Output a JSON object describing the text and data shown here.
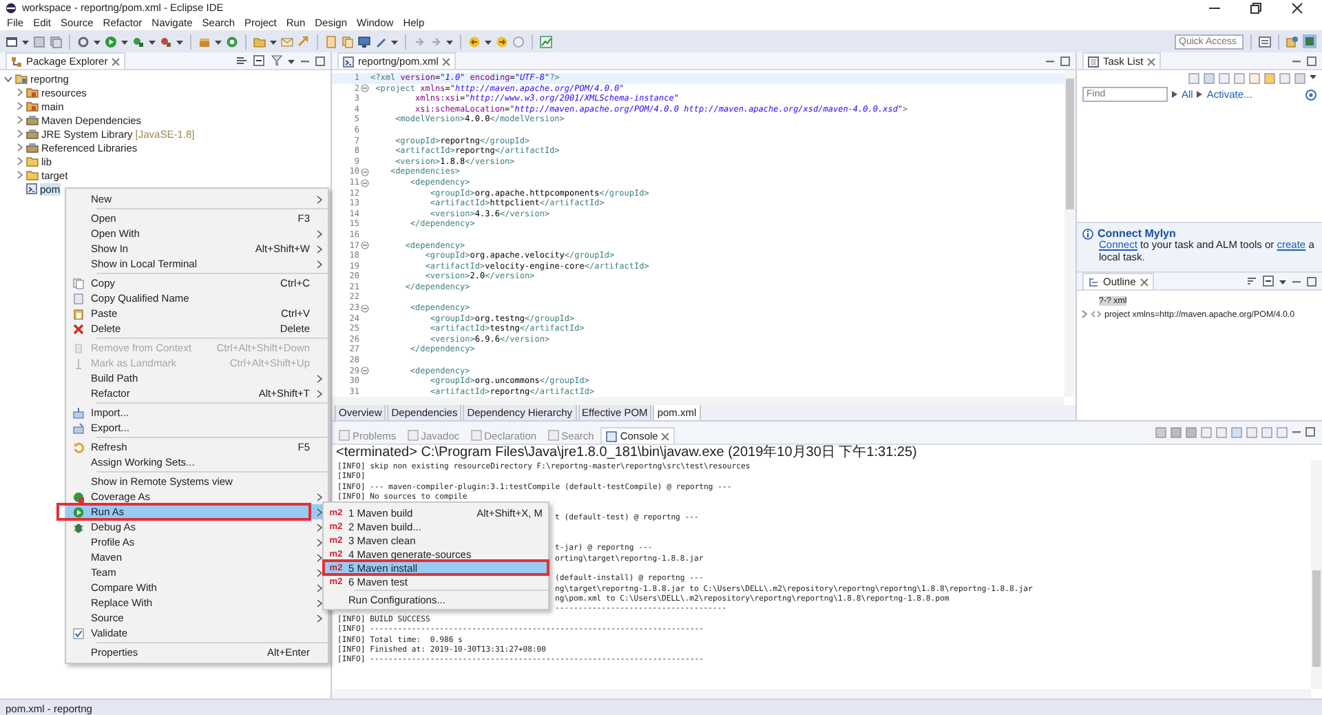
{
  "window": {
    "title": "workspace - reportng/pom.xml - Eclipse IDE"
  },
  "menu_bar": [
    "File",
    "Edit",
    "Source",
    "Refactor",
    "Navigate",
    "Search",
    "Project",
    "Run",
    "Design",
    "Window",
    "Help"
  ],
  "quick_access": {
    "placeholder": "Quick Access"
  },
  "package_explorer": {
    "title": "Package Explorer",
    "tree": [
      {
        "label": "reportng",
        "kind": "project",
        "expanded": true,
        "selected": false,
        "children": [
          {
            "label": "resources",
            "kind": "source-folder",
            "expanded": false,
            "selected": false
          },
          {
            "label": "main",
            "kind": "source-folder",
            "expanded": false,
            "selected": false
          },
          {
            "label": "Maven Dependencies",
            "kind": "library",
            "expanded": false,
            "selected": false
          },
          {
            "label": "JRE System Library",
            "decoration": "[JavaSE-1.8]",
            "kind": "library",
            "expanded": false,
            "selected": false
          },
          {
            "label": "Referenced Libraries",
            "kind": "library",
            "expanded": false,
            "selected": false
          },
          {
            "label": "lib",
            "kind": "folder",
            "expanded": false,
            "selected": false
          },
          {
            "label": "target",
            "kind": "folder",
            "expanded": false,
            "selected": false
          },
          {
            "label": "pom",
            "kind": "file",
            "selected": true
          }
        ]
      }
    ]
  },
  "editor": {
    "tab": "reportng/pom.xml",
    "lines": [
      {
        "num": "1",
        "code": "<?xml version=\"1.0\" encoding=\"UTF-8\"?>",
        "fold": false,
        "current": true
      },
      {
        "num": "2",
        "code": " <project xmlns=\"http://maven.apache.org/POM/4.0.0\"",
        "fold": true,
        "current": false
      },
      {
        "num": "3",
        "code": "         xmlns:xsi=\"http://www.w3.org/2001/XMLSchema-instance\"",
        "fold": false,
        "current": false
      },
      {
        "num": "4",
        "code": "         xsi:schemaLocation=\"http://maven.apache.org/POM/4.0.0 http://maven.apache.org/xsd/maven-4.0.0.xsd\">",
        "fold": false,
        "current": false
      },
      {
        "num": "5",
        "code": "     <modelVersion>4.0.0</modelVersion>",
        "fold": false,
        "current": false
      },
      {
        "num": "6",
        "fold": false,
        "current": false
      },
      {
        "num": "7",
        "code": "     <groupId>reportng</groupId>",
        "fold": false,
        "current": false
      },
      {
        "num": "8",
        "code": "     <artifactId>reportng</artifactId>",
        "fold": false,
        "current": false
      },
      {
        "num": "9",
        "code": "     <version>1.8.8</version>",
        "fold": false,
        "current": false
      },
      {
        "num": "10",
        "code": "    <dependencies>",
        "fold": true,
        "current": false
      },
      {
        "num": "11",
        "code": "        <dependency>",
        "fold": true,
        "current": false
      },
      {
        "num": "12",
        "code": "            <groupId>org.apache.httpcomponents</groupId>",
        "fold": false,
        "current": false
      },
      {
        "num": "13",
        "code": "            <artifactId>httpclient</artifactId>",
        "fold": false,
        "current": false
      },
      {
        "num": "14",
        "code": "            <version>4.3.6</version>",
        "fold": false,
        "current": false
      },
      {
        "num": "15",
        "code": "        </dependency>",
        "fold": false,
        "current": false
      },
      {
        "num": "16",
        "fold": false,
        "current": false
      },
      {
        "num": "17",
        "code": "       <dependency>",
        "fold": true,
        "current": false
      },
      {
        "num": "18",
        "code": "           <groupId>org.apache.velocity</groupId>",
        "fold": false,
        "current": false
      },
      {
        "num": "19",
        "code": "           <artifactId>velocity-engine-core</artifactId>",
        "fold": false,
        "current": false
      },
      {
        "num": "20",
        "code": "           <version>2.0</version>",
        "fold": false,
        "current": false
      },
      {
        "num": "21",
        "code": "       </dependency>",
        "fold": false,
        "current": false
      },
      {
        "num": "22",
        "fold": false,
        "current": false
      },
      {
        "num": "23",
        "code": "        <dependency>",
        "fold": true,
        "current": false
      },
      {
        "num": "24",
        "code": "            <groupId>org.testng</groupId>",
        "fold": false,
        "current": false
      },
      {
        "num": "25",
        "code": "            <artifactId>testng</artifactId>",
        "fold": false,
        "current": false
      },
      {
        "num": "26",
        "code": "            <version>6.9.6</version>",
        "fold": false,
        "current": false
      },
      {
        "num": "27",
        "code": "        </dependency>",
        "fold": false,
        "current": false
      },
      {
        "num": "28",
        "fold": false,
        "current": false
      },
      {
        "num": "29",
        "code": "        <dependency>",
        "fold": true,
        "current": false
      },
      {
        "num": "30",
        "code": "            <groupId>org.uncommons</groupId>",
        "fold": false,
        "current": false
      },
      {
        "num": "31",
        "code": "            <artifactId>reportng</artifactId>",
        "fold": false,
        "current": false
      }
    ],
    "bottom_tabs": [
      {
        "label": "Overview",
        "selected": false
      },
      {
        "label": "Dependencies",
        "selected": false
      },
      {
        "label": "Dependency Hierarchy",
        "selected": false
      },
      {
        "label": "Effective POM",
        "selected": false
      },
      {
        "label": "pom.xml",
        "selected": true
      }
    ]
  },
  "task_list": {
    "title": "Task List",
    "find": {
      "placeholder": "Find"
    },
    "filters": [
      "All",
      "Activate..."
    ]
  },
  "mylyn": {
    "title": "Connect Mylyn",
    "message": [
      {
        "text": "Connect",
        "link": true
      },
      {
        "text": " to your task and ALM tools or ",
        "link": false
      },
      {
        "text": "create",
        "link": true
      },
      {
        "text": " a local task.",
        "link": false
      }
    ]
  },
  "outline": {
    "title": "Outline",
    "items": [
      {
        "label": "?-? xml",
        "kind": "instruction",
        "selected": true
      },
      {
        "label": "project xmlns=http://maven.apache.org/POM/4.0.0",
        "kind": "element",
        "selected": false
      }
    ]
  },
  "console": {
    "tabs": [
      {
        "label": "Problems",
        "selected": false
      },
      {
        "label": "Javadoc",
        "selected": false
      },
      {
        "label": "Declaration",
        "selected": false
      },
      {
        "label": "Search",
        "selected": false
      },
      {
        "label": "Console",
        "selected": true
      }
    ],
    "process": "<terminated> C:\\Program Files\\Java\\jre1.8.0_181\\bin\\javaw.exe (2019年10月30日 下午1:31:25)",
    "lines": [
      {
        "kind": "full",
        "text": "[INFO] skip non existing resourceDirectory F:\\reportng-master\\reportng\\src\\test\\resources"
      },
      {
        "kind": "full",
        "text": "[INFO]"
      },
      {
        "kind": "full",
        "text": "[INFO] --- maven-compiler-plugin:3.1:testCompile (default-testCompile) @ reportng ---"
      },
      {
        "kind": "full",
        "text": "[INFO] No sources to compile"
      },
      {
        "kind": "covered"
      },
      {
        "kind": "partial",
        "text": "t (default-test) @ reportng ---"
      },
      {
        "kind": "covered"
      },
      {
        "kind": "covered"
      },
      {
        "kind": "partial",
        "text": "t-jar) @ reportng ---"
      },
      {
        "kind": "partial",
        "text": "orting\\target\\reportng-1.8.8.jar"
      },
      {
        "kind": "covered"
      },
      {
        "kind": "partial",
        "text": "(default-install) @ reportng ---"
      },
      {
        "kind": "partial",
        "text": "ng\\target\\reportng-1.8.8.jar to C:\\Users\\DELL\\.m2\\repository\\reportng\\reportng\\1.8.8\\reportng-1.8.8.jar"
      },
      {
        "kind": "partial",
        "text": "ng\\pom.xml to C:\\Users\\DELL\\.m2\\repository\\reportng\\reportng\\1.8.8\\reportng-1.8.8.pom"
      },
      {
        "kind": "partial",
        "text": "-------------------------------------"
      },
      {
        "kind": "full",
        "text": "[INFO] BUILD SUCCESS"
      },
      {
        "kind": "full",
        "text": "[INFO] ------------------------------------------------------------------------"
      },
      {
        "kind": "full",
        "text": "[INFO] Total time:  0.986 s"
      },
      {
        "kind": "full",
        "text": "[INFO] Finished at: 2019-10-30T13:31:27+08:00"
      },
      {
        "kind": "full",
        "text": "[INFO] ------------------------------------------------------------------------"
      }
    ]
  },
  "context_menu": {
    "items": [
      {
        "kind": "item",
        "label": "New",
        "submenu": true,
        "disabled": false,
        "selected": false,
        "outlined": false
      },
      {
        "kind": "separator"
      },
      {
        "kind": "item",
        "label": "Open",
        "shortcut": "F3",
        "submenu": false,
        "disabled": false,
        "selected": false,
        "outlined": false
      },
      {
        "kind": "item",
        "label": "Open With",
        "submenu": true,
        "disabled": false,
        "selected": false,
        "outlined": false
      },
      {
        "kind": "item",
        "label": "Show In",
        "shortcut": "Alt+Shift+W",
        "submenu": true,
        "disabled": false,
        "selected": false,
        "outlined": false
      },
      {
        "kind": "item",
        "label": "Show in Local Terminal",
        "submenu": true,
        "disabled": false,
        "selected": false,
        "outlined": false
      },
      {
        "kind": "separator"
      },
      {
        "kind": "item",
        "label": "Copy",
        "shortcut": "Ctrl+C",
        "submenu": false,
        "disabled": false,
        "selected": false,
        "outlined": false
      },
      {
        "kind": "item",
        "label": "Copy Qualified Name",
        "submenu": false,
        "disabled": false,
        "selected": false,
        "outlined": false
      },
      {
        "kind": "item",
        "label": "Paste",
        "shortcut": "Ctrl+V",
        "submenu": false,
        "disabled": false,
        "selected": false,
        "outlined": false
      },
      {
        "kind": "item",
        "label": "Delete",
        "shortcut": "Delete",
        "submenu": false,
        "disabled": false,
        "selected": false,
        "outlined": false
      },
      {
        "kind": "separator"
      },
      {
        "kind": "item",
        "label": "Remove from Context",
        "shortcut": "Ctrl+Alt+Shift+Down",
        "submenu": false,
        "disabled": true,
        "selected": false,
        "outlined": false
      },
      {
        "kind": "item",
        "label": "Mark as Landmark",
        "shortcut": "Ctrl+Alt+Shift+Up",
        "submenu": false,
        "disabled": true,
        "selected": false,
        "outlined": false
      },
      {
        "kind": "item",
        "label": "Build Path",
        "submenu": true,
        "disabled": false,
        "selected": false,
        "outlined": false
      },
      {
        "kind": "item",
        "label": "Refactor",
        "shortcut": "Alt+Shift+T",
        "submenu": true,
        "disabled": false,
        "selected": false,
        "outlined": false
      },
      {
        "kind": "separator"
      },
      {
        "kind": "item",
        "label": "Import...",
        "submenu": false,
        "disabled": false,
        "selected": false,
        "outlined": false
      },
      {
        "kind": "item",
        "label": "Export...",
        "submenu": false,
        "disabled": false,
        "selected": false,
        "outlined": false
      },
      {
        "kind": "separator"
      },
      {
        "kind": "item",
        "label": "Refresh",
        "shortcut": "F5",
        "submenu": false,
        "disabled": false,
        "selected": false,
        "outlined": false
      },
      {
        "kind": "item",
        "label": "Assign Working Sets...",
        "submenu": false,
        "disabled": false,
        "selected": false,
        "outlined": false
      },
      {
        "kind": "separator"
      },
      {
        "kind": "item",
        "label": "Show in Remote Systems view",
        "submenu": false,
        "disabled": false,
        "selected": false,
        "outlined": false
      },
      {
        "kind": "item",
        "label": "Coverage As",
        "submenu": true,
        "disabled": false,
        "selected": false,
        "outlined": false
      },
      {
        "kind": "item",
        "label": "Run As",
        "submenu": true,
        "disabled": false,
        "selected": true,
        "outlined": true
      },
      {
        "kind": "item",
        "label": "Debug As",
        "submenu": true,
        "disabled": false,
        "selected": false,
        "outlined": false
      },
      {
        "kind": "item",
        "label": "Profile As",
        "submenu": true,
        "disabled": false,
        "selected": false,
        "outlined": false
      },
      {
        "kind": "item",
        "label": "Maven",
        "submenu": true,
        "disabled": false,
        "selected": false,
        "outlined": false
      },
      {
        "kind": "item",
        "label": "Team",
        "submenu": true,
        "disabled": false,
        "selected": false,
        "outlined": false
      },
      {
        "kind": "item",
        "label": "Compare With",
        "submenu": true,
        "disabled": false,
        "selected": false,
        "outlined": false
      },
      {
        "kind": "item",
        "label": "Replace With",
        "submenu": true,
        "disabled": false,
        "selected": false,
        "outlined": false
      },
      {
        "kind": "item",
        "label": "Source",
        "submenu": true,
        "disabled": false,
        "selected": false,
        "outlined": false
      },
      {
        "kind": "item",
        "label": "Validate",
        "submenu": false,
        "disabled": false,
        "selected": false,
        "outlined": false
      },
      {
        "kind": "separator"
      },
      {
        "kind": "item",
        "label": "Properties",
        "shortcut": "Alt+Enter",
        "submenu": false,
        "disabled": false,
        "selected": false,
        "outlined": false
      }
    ]
  },
  "run_as_menu": {
    "items": [
      {
        "kind": "item",
        "badge": "m2",
        "label": "1 Maven build",
        "shortcut": "Alt+Shift+X, M",
        "selected": false,
        "outlined": false
      },
      {
        "kind": "item",
        "badge": "m2",
        "label": "2 Maven build...",
        "selected": false,
        "outlined": false
      },
      {
        "kind": "item",
        "badge": "m2",
        "label": "3 Maven clean",
        "selected": false,
        "outlined": false
      },
      {
        "kind": "item",
        "badge": "m2",
        "label": "4 Maven generate-sources",
        "selected": false,
        "outlined": false
      },
      {
        "kind": "item",
        "badge": "m2",
        "label": "5 Maven install",
        "selected": true,
        "outlined": true
      },
      {
        "kind": "item",
        "badge": "m2",
        "label": "6 Maven test",
        "selected": false,
        "outlined": false
      },
      {
        "kind": "separator"
      },
      {
        "kind": "item",
        "label": "Run Configurations...",
        "selected": false,
        "outlined": false
      }
    ]
  },
  "status_bar": {
    "text": "pom.xml - reportng"
  }
}
